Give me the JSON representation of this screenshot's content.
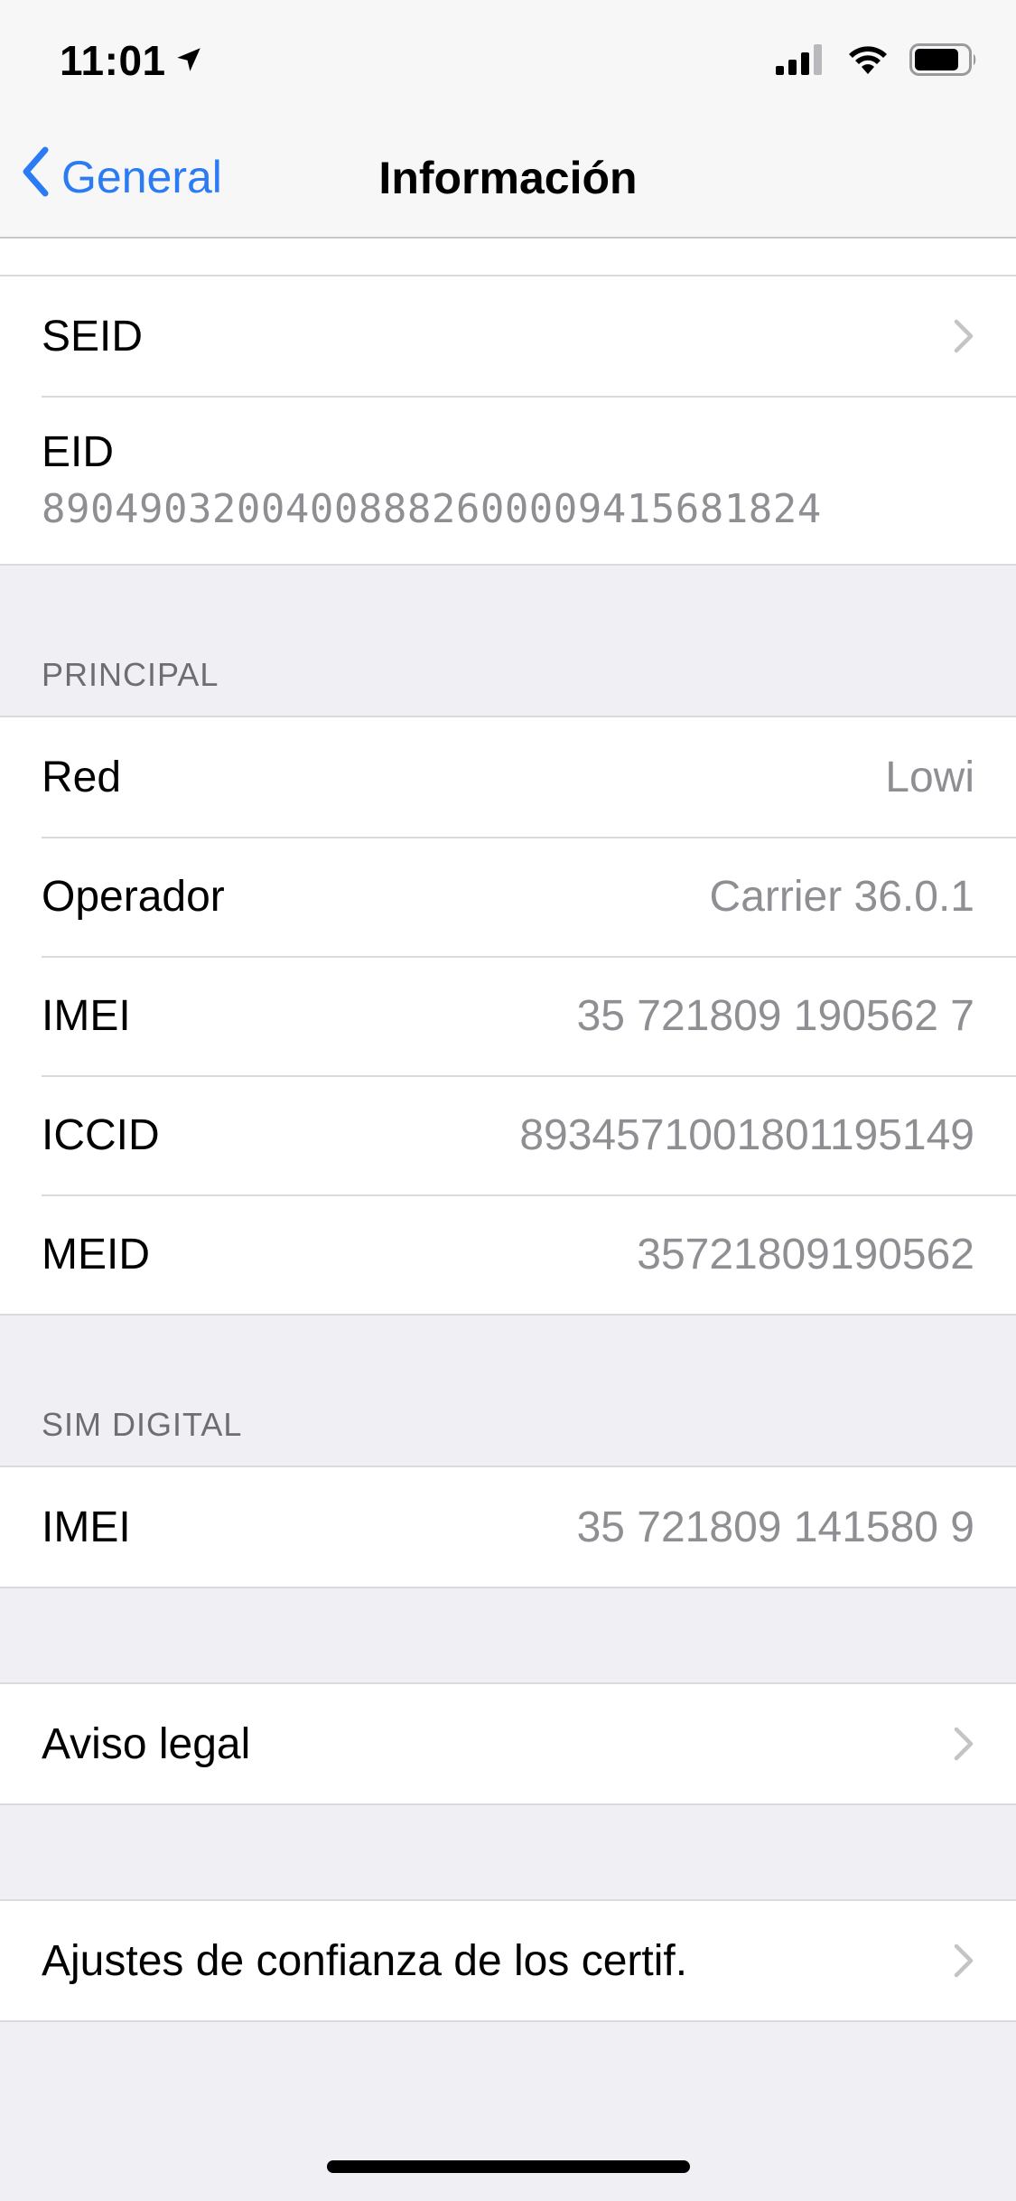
{
  "status": {
    "time": "11:01",
    "signal_bars": 4,
    "battery_level": 0.85
  },
  "nav": {
    "back_label": "General",
    "title": "Información"
  },
  "top_group": {
    "seid_label": "SEID",
    "eid_label": "EID",
    "eid_value": "89049032004008882600009415681824"
  },
  "principal": {
    "header": "PRINCIPAL",
    "rows": [
      {
        "label": "Red",
        "value": "Lowi"
      },
      {
        "label": "Operador",
        "value": "Carrier 36.0.1"
      },
      {
        "label": "IMEI",
        "value": "35 721809 190562 7"
      },
      {
        "label": "ICCID",
        "value": "8934571001801195149"
      },
      {
        "label": "MEID",
        "value": "35721809190562"
      }
    ]
  },
  "sim_digital": {
    "header": "SIM DIGITAL",
    "rows": [
      {
        "label": "IMEI",
        "value": "35 721809 141580 9"
      }
    ]
  },
  "legal": {
    "label": "Aviso legal"
  },
  "certs": {
    "label": "Ajustes de confianza de los certif."
  },
  "colors": {
    "accent": "#2a7bf4",
    "background": "#efeff4",
    "secondary_text": "#8e8e93",
    "separator": "#d9d9de"
  },
  "icons": {
    "location": "location-arrow-icon",
    "signal": "cellular-signal-icon",
    "wifi": "wifi-icon",
    "battery": "battery-icon",
    "back": "chevron-left-icon",
    "disclosure": "chevron-right-icon"
  }
}
